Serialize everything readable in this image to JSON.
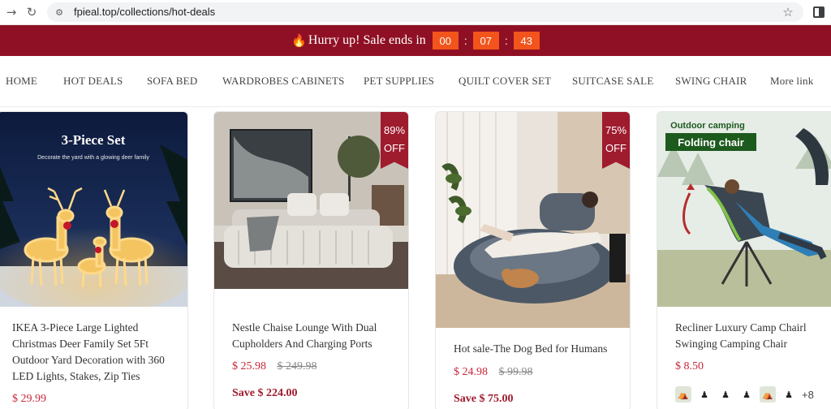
{
  "browser": {
    "back_icon": "arrow-right-icon",
    "reload_icon": "reload-icon",
    "url": "fpieal.top/collections/hot-deals",
    "star_icon": "star-icon",
    "side_panel_icon": "side-panel-icon"
  },
  "announcement": {
    "message": "Hurry up! Sale ends in",
    "timer": {
      "hours": "00",
      "minutes": "07",
      "seconds": "43"
    },
    "background": "#8f1024",
    "timer_color": "#f2541b"
  },
  "menu": {
    "items": [
      {
        "label": "HOME"
      },
      {
        "label": "HOT DEALS"
      },
      {
        "label": "SOFA BED"
      },
      {
        "label": "WARDROBES CABINETS"
      },
      {
        "label": "PET SUPPLIES"
      },
      {
        "label": "QUILT COVER SET"
      },
      {
        "label": "SUITCASE SALE"
      },
      {
        "label": "SWING CHAIR"
      },
      {
        "label": "More link"
      }
    ]
  },
  "products": [
    {
      "image_heading": "3-Piece Set",
      "image_subheading": "Decorate the yard with a glowing deer family",
      "title": "IKEA 3-Piece Large Lighted Christmas Deer Family Set 5Ft Outdoor Yard Decoration with 360 LED Lights, Stakes, Zip Ties",
      "price": "$ 29.99"
    },
    {
      "badge_line1": "89%",
      "badge_line2": "OFF",
      "title": "Nestle Chaise Lounge With Dual Cupholders And Charging Ports",
      "price": "$ 25.98",
      "compare_price": "$ 249.98",
      "save": "Save $ 224.00"
    },
    {
      "badge_line1": "75%",
      "badge_line2": "OFF",
      "title": "Hot sale-The Dog Bed for Humans",
      "price": "$ 24.98",
      "compare_price": "$ 99.98",
      "save": "Save $ 75.00"
    },
    {
      "image_heading_1": "Outdoor camping",
      "image_heading_2": "Folding chair",
      "title": "Recliner Luxury Camp Chairl Swinging Camping Chair",
      "price": "$ 8.50",
      "swatches_more": "+8"
    }
  ],
  "colors": {
    "accent": "#9f1b2e",
    "price": "#c6283a"
  }
}
